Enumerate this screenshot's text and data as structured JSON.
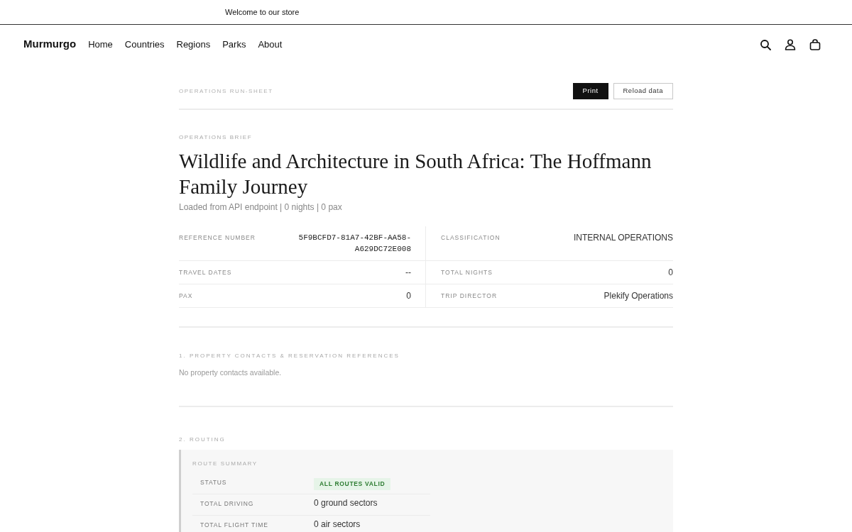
{
  "announcement": "Welcome to our store",
  "nav": {
    "logo": "Murmurgo",
    "links": [
      "Home",
      "Countries",
      "Regions",
      "Parks",
      "About"
    ],
    "actions": [
      {
        "kind": "search"
      },
      {
        "kind": "account"
      },
      {
        "kind": "bag"
      }
    ]
  },
  "toolbar": {
    "label": "OPERATIONS RUN-SHEET",
    "buttons": [
      {
        "label": "Print",
        "kind": "primary"
      },
      {
        "label": "Reload data",
        "kind": "secondary"
      }
    ]
  },
  "brief": {
    "eyebrow": "OPERATIONS BRIEF",
    "title": "Wildlife and Architecture in South Africa: The Hoffmann Family Journey",
    "subtitle": "Loaded from API endpoint | 0 nights | 0 pax"
  },
  "details": [
    {
      "label": "REFERENCE NUMBER",
      "value": "5F9BCFD7-81A7-42BF-AA58-A629DC72E008",
      "kind": "mono"
    },
    {
      "label": "CLASSIFICATION",
      "value": "INTERNAL OPERATIONS",
      "kind": "text"
    },
    {
      "label": "TRAVEL DATES",
      "value": "--",
      "kind": "text"
    },
    {
      "label": "TOTAL NIGHTS",
      "value": "0",
      "kind": "text"
    },
    {
      "label": "PAX",
      "value": "0",
      "kind": "text"
    },
    {
      "label": "TRIP DIRECTOR",
      "value": "Plekify Operations",
      "kind": "text"
    }
  ],
  "sections": [
    {
      "heading": "1. PROPERTY CONTACTS & RESERVATION REFERENCES",
      "empty_text": "No property contacts available."
    },
    {
      "heading": "2. ROUTING",
      "summary": {
        "title": "ROUTE SUMMARY",
        "rows": [
          {
            "label": "STATUS",
            "value": "ALL ROUTES VALID",
            "kind": "badge"
          },
          {
            "label": "TOTAL DRIVING",
            "value": "0 ground sectors",
            "kind": "text"
          },
          {
            "label": "TOTAL FLIGHT TIME",
            "value": "0 air sectors",
            "kind": "text"
          }
        ]
      }
    }
  ]
}
